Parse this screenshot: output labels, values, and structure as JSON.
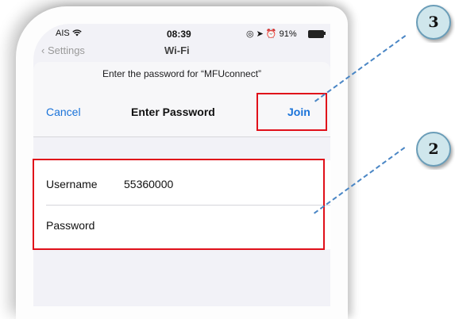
{
  "status_bar": {
    "carrier": "AIS",
    "wifi_icon": "wifi-icon",
    "time": "08:39",
    "battery": "91%",
    "right_icons": "◎ ➤ ⏰ 91%"
  },
  "background_nav": {
    "back_label": "Settings",
    "title": "Wi-Fi"
  },
  "sheet": {
    "prompt": "Enter the password for “MFUconnect”",
    "cancel_label": "Cancel",
    "title": "Enter Password",
    "join_label": "Join"
  },
  "form": {
    "username_label": "Username",
    "username_value": "55360000",
    "password_label": "Password",
    "password_value": ""
  },
  "annotations": {
    "badge_join": "3",
    "badge_form": "2",
    "highlight_color": "#e0101a",
    "leader_color": "#4a86c5"
  }
}
